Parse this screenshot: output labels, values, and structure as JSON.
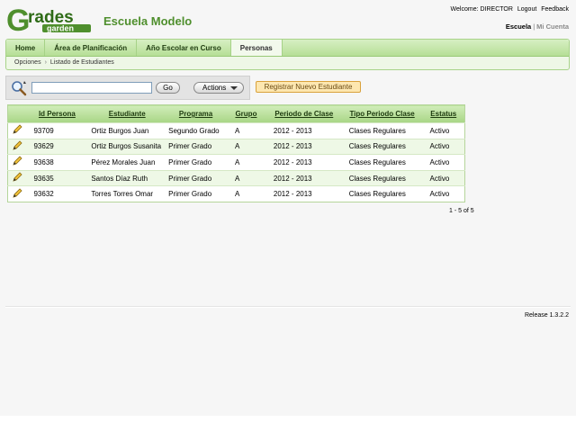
{
  "logo": {
    "word1": "rades",
    "word2": "garden",
    "letter": "G",
    "colors": {
      "green": "#4f8f2d",
      "darkgreen": "#2e6b16"
    }
  },
  "header": {
    "school_name": "Escuela Modelo",
    "welcome": "Welcome: DIRECTOR",
    "logout": "Logout",
    "feedback": "Feedback",
    "account_current": "Escuela",
    "account_separator": "|",
    "account_other": "Mi Cuenta"
  },
  "nav": {
    "tabs": [
      {
        "label": "Home"
      },
      {
        "label": "Área de Planificación"
      },
      {
        "label": "Año Escolar en Curso"
      },
      {
        "label": "Personas",
        "active": true
      }
    ],
    "breadcrumb": {
      "parent": "Opciones",
      "current": "Listado de Estudiantes"
    }
  },
  "search": {
    "icon": "magnifier-icon",
    "value": "",
    "go_label": "Go",
    "actions_label": "Actions",
    "register_label": "Registrar Nuevo Estudiante"
  },
  "table": {
    "columns": [
      "Id Persona",
      "Estudiante",
      "Programa",
      "Grupo",
      "Periodo de Clase",
      "Tipo Periodo Clase",
      "Estatus"
    ],
    "rows": [
      [
        "93709",
        "Ortiz Burgos Juan",
        "Segundo Grado",
        "A",
        "2012 - 2013",
        "Clases Regulares",
        "Activo"
      ],
      [
        "93629",
        "Ortiz Burgos Susanita",
        "Primer Grado",
        "A",
        "2012 - 2013",
        "Clases Regulares",
        "Activo"
      ],
      [
        "93638",
        "Pérez Morales Juan",
        "Primer Grado",
        "A",
        "2012 - 2013",
        "Clases Regulares",
        "Activo"
      ],
      [
        "93635",
        "Santos Díaz Ruth",
        "Primer Grado",
        "A",
        "2012 - 2013",
        "Clases Regulares",
        "Activo"
      ],
      [
        "93632",
        "Torres Torres Omar",
        "Primer Grado",
        "A",
        "2012 - 2013",
        "Clases Regulares",
        "Activo"
      ]
    ],
    "edit_icon": "pencil-icon",
    "pagination": "1 - 5 of 5"
  },
  "footer": {
    "release": "Release 1.3.2.2"
  }
}
